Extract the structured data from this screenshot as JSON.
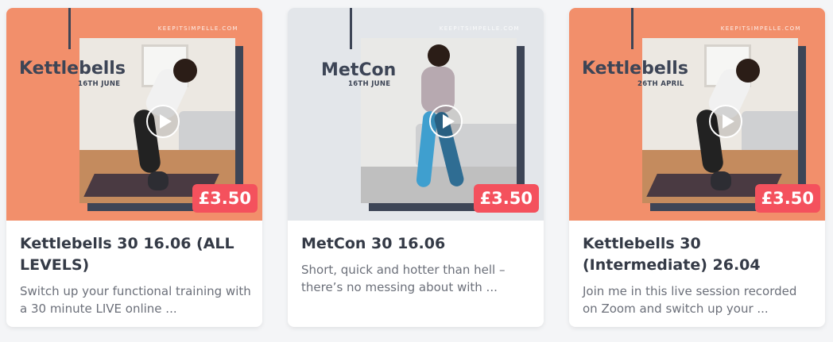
{
  "cards": [
    {
      "thumb_title": "Kettlebells",
      "thumb_date": "16TH JUNE",
      "site": "KEEPITSIMPELLE.COM",
      "price": "£3.50",
      "title": "Kettlebells 30 16.06 (ALL LEVELS)",
      "description": "Switch up your functional training with a 30 minute LIVE online ...",
      "bg_color": "#f28f6b"
    },
    {
      "thumb_title": "MetCon",
      "thumb_date": "16TH JUNE",
      "site": "KEEPITSIMPELLE.COM",
      "price": "£3.50",
      "title": "MetCon 30 16.06",
      "description": "Short, quick and hotter than hell – there’s no messing about with ...",
      "bg_color": "#e3e6ea"
    },
    {
      "thumb_title": "Kettlebells",
      "thumb_date": "26TH APRIL",
      "site": "KEEPITSIMPELLE.COM",
      "price": "£3.50",
      "title": "Kettlebells 30 (Intermediate) 26.04",
      "description": "Join me in this live session recorded on Zoom and switch up your ...",
      "bg_color": "#f28f6b"
    }
  ],
  "colors": {
    "accent_price": "#f4515d",
    "title_text": "#343a46",
    "desc_text": "#6b6f79"
  }
}
